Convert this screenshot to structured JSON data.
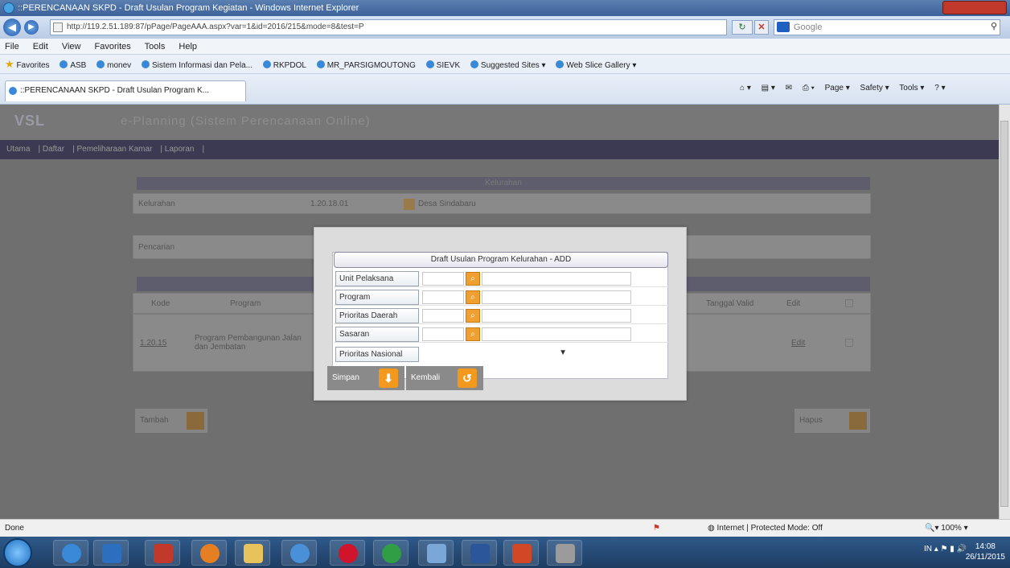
{
  "window": {
    "title": "::PERENCANAAN SKPD - Draft Usulan Program Kegiatan - Windows Internet Explorer"
  },
  "addressbar": {
    "url": "http://119.2.51.189:87/pPage/PageAAA.aspx?var=1&id=2016/215&mode=8&test=P",
    "search_placeholder": "Google"
  },
  "menubar": {
    "items": [
      "File",
      "Edit",
      "View",
      "Favorites",
      "Tools",
      "Help"
    ]
  },
  "favorites": {
    "label": "Favorites",
    "items": [
      "ASB",
      "monev",
      "Sistem Informasi dan Pela...",
      "RKPDOL",
      "MR_PARSIGMOUTONG",
      "SIEVK",
      "Suggested Sites ▾",
      "Web Slice Gallery ▾"
    ]
  },
  "tab": {
    "title": "::PERENCANAAN SKPD - Draft Usulan Program K..."
  },
  "commandbar": {
    "items": [
      "Page ▾",
      "Safety ▾",
      "Tools ▾"
    ]
  },
  "site": {
    "logo": "VSL",
    "title": "e-Planning (Sistem Perencanaan Online)",
    "nav": [
      "Utama",
      "Daftar",
      "Pemeliharaan Kamar",
      "Laporan"
    ]
  },
  "background_form": {
    "section_header": "Kelurahan",
    "kelurahan_label": "Kelurahan",
    "kelurahan_code": "1.20.18.01",
    "kelurahan_button": "Desa Sindabaru",
    "pencarian_label": "Pencarian",
    "table_headers": [
      "Kode",
      "Program",
      "Tanggal Valid",
      "Edit"
    ],
    "table_rows": [
      {
        "kode": "1.20.15",
        "program": "Program Pembangunan Jalan dan Jembatan",
        "edit": "Edit"
      }
    ],
    "tambah_label": "Tambah",
    "hapus_label": "Hapus"
  },
  "modal": {
    "title": "Draft Usulan Program Kelurahan - ADD",
    "fields": [
      {
        "label": "Unit Pelaksana",
        "code": "",
        "name": ""
      },
      {
        "label": "Program",
        "code": "",
        "name": ""
      },
      {
        "label": "Prioritas Daerah",
        "code": "",
        "name": ""
      },
      {
        "label": "Sasaran",
        "code": "",
        "name": ""
      }
    ],
    "prioritas_nasional": {
      "label": "Prioritas Nasional",
      "value": ""
    },
    "simpan_label": "Simpan",
    "kembali_label": "Kembali"
  },
  "statusbar": {
    "left": "Done",
    "zone": "Internet | Protected Mode: Off",
    "zoom": "100%"
  },
  "taskbar": {
    "apps": [
      "internet-explorer",
      "outlook",
      "acrobat",
      "firefox",
      "explorer",
      "chrome-alt",
      "opera",
      "chrome",
      "tool",
      "word",
      "powerpoint",
      "other"
    ],
    "time": "14:08",
    "date": "26/11/2015",
    "tray_lang": "IN"
  },
  "colors": {
    "accent": "#f39a1e",
    "nav_bg": "#3b3a52",
    "overlay": "#6f6f6f"
  }
}
